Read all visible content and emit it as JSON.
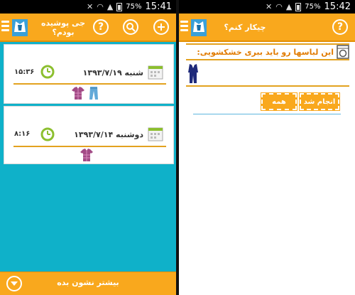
{
  "status": {
    "left": {
      "battery": "75%",
      "time": "15:41"
    },
    "right": {
      "battery": "75%",
      "time": "15:42"
    }
  },
  "left_screen": {
    "title_line1": "جی پوشیده",
    "title_line2": "بودم؟",
    "help_label": "?",
    "entries": [
      {
        "date": "شنبه ۱۳۹۳/۷/۱۹",
        "time": "۱۵:۳۶",
        "clothes": [
          "shirt-icon",
          "pants-icon"
        ]
      },
      {
        "date": "دوشنبه ۱۳۹۳/۷/۱۴",
        "time": "۸:۱۶",
        "clothes": [
          "shirt-icon"
        ]
      }
    ],
    "show_more_label": "بیشتر نشون بده"
  },
  "right_screen": {
    "title": "چیکار کنم؟",
    "help_label": "?",
    "task_text": "این لباسها رو باید ببری خشکشویی:",
    "done_label": "انجام شد",
    "all_label": "همه"
  },
  "colors": {
    "accent": "#f9a81d",
    "background": "#0fb1c9",
    "task_text": "#e17b00"
  }
}
